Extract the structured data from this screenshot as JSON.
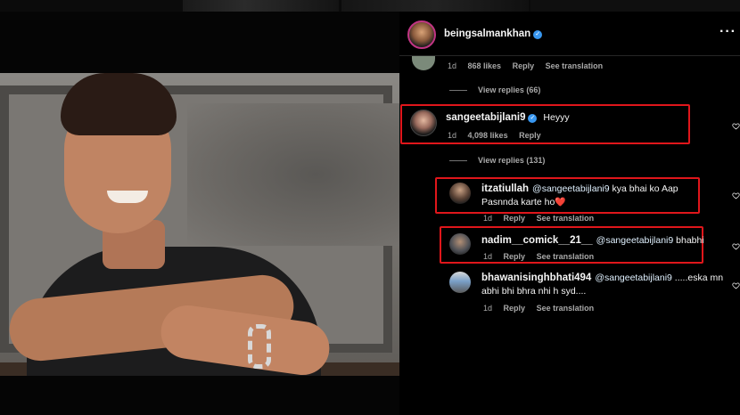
{
  "account": {
    "username": "beingsalmankhan",
    "verified": true
  },
  "top_comment": {
    "age": "1d",
    "likes": "868 likes",
    "reply": "Reply",
    "translate": "See translation",
    "view_replies": "View replies (66)"
  },
  "main_comment": {
    "username": "sangeetabijlani9",
    "verified": true,
    "text": "Heyyy",
    "age": "1d",
    "likes": "4,098 likes",
    "reply": "Reply",
    "view_replies": "View replies (131)"
  },
  "replies": [
    {
      "username": "itzatiullah",
      "mention": "@sangeetabijlani9",
      "text_line1": " kya bhai ko Aap",
      "text_line2": "Pasnnda karte ho",
      "emoji": "❤️",
      "age": "1d",
      "reply": "Reply",
      "translate": "See translation"
    },
    {
      "username": "nadim__comick__21__",
      "mention": "@sangeetabijlani9",
      "text_line1": " bhabhi",
      "age": "1d",
      "reply": "Reply",
      "translate": "See translation"
    },
    {
      "username": "bhawanisinghbhati494",
      "mention": "@sangeetabijlani9",
      "text_line1": " .....eska mn",
      "text_line2": "abhi bhi bhra nhi h syd....",
      "age": "1d",
      "reply": "Reply",
      "translate": "See translation"
    }
  ],
  "colors": {
    "highlight": "#e0161b",
    "verified": "#3897f0",
    "muted": "#a8a8a8"
  },
  "icons": [
    "more-options-icon",
    "verified-badge-icon",
    "heart-outline-icon"
  ]
}
